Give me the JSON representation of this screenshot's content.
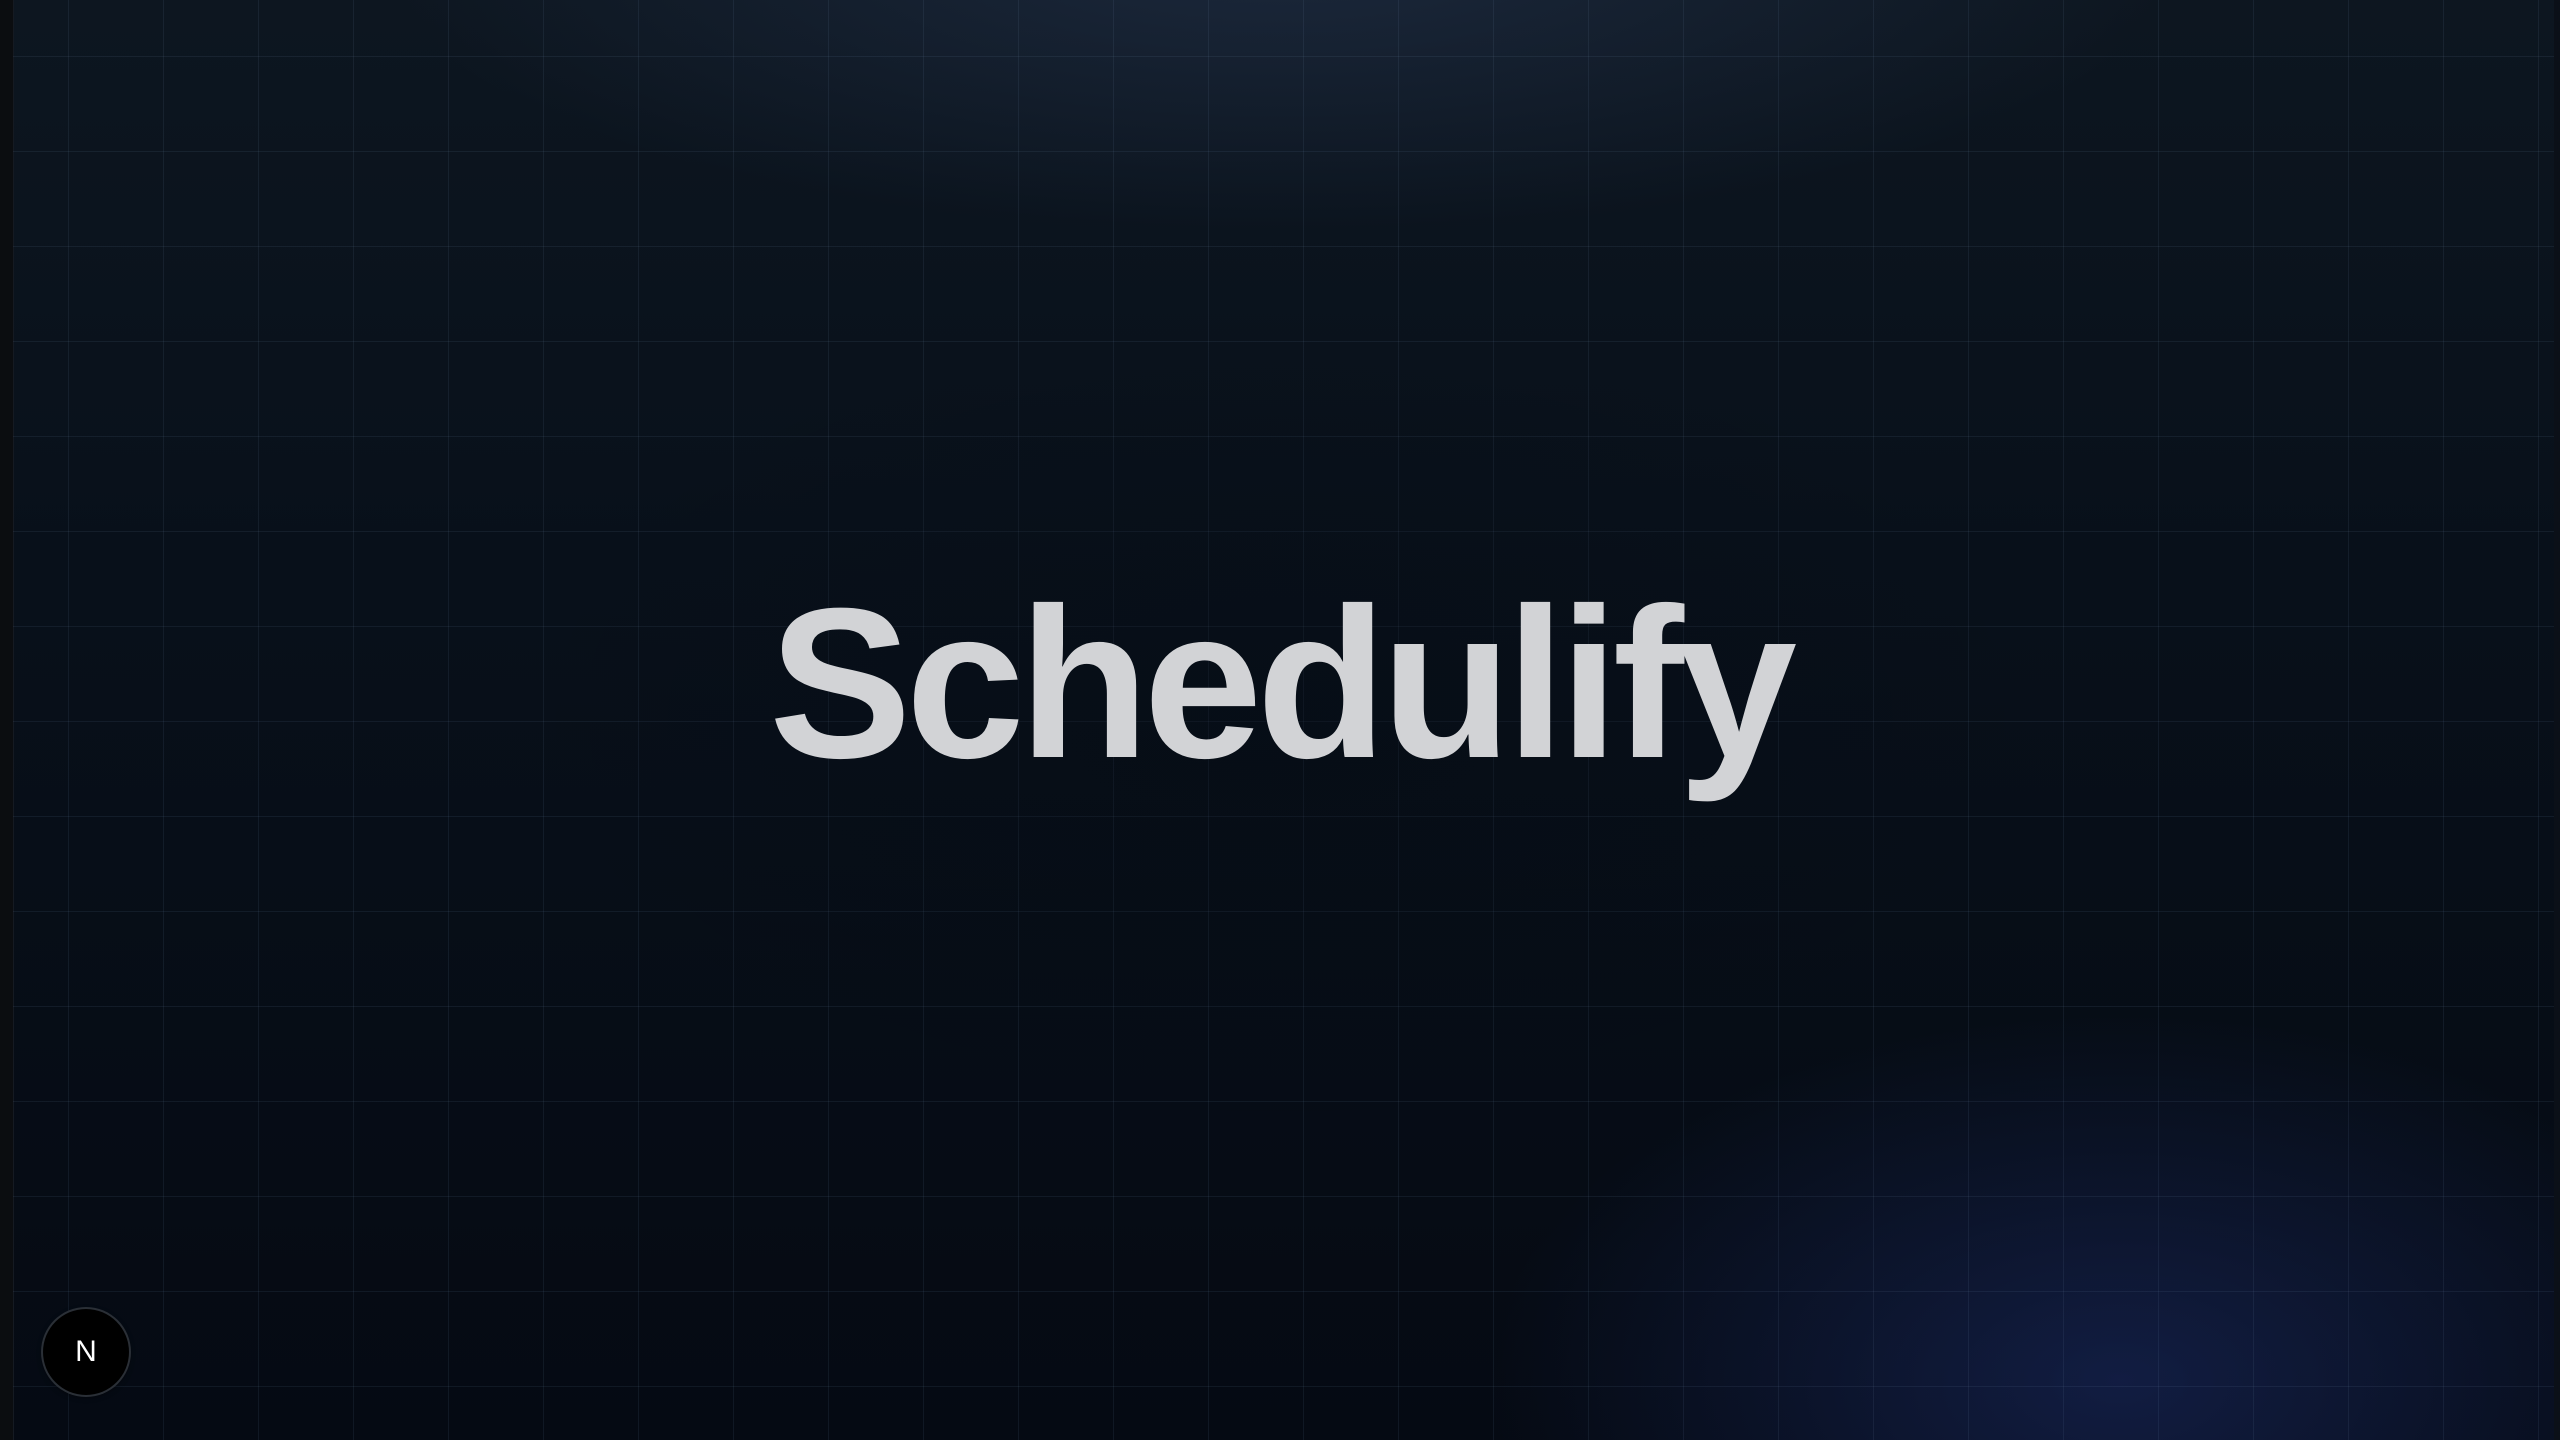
{
  "app": {
    "title": "Schedulify"
  },
  "dev_badge": {
    "letter": "N",
    "icon": "nextjs-logo-icon"
  },
  "colors": {
    "background": "#050a13",
    "title_text": "#d2d3d6",
    "grid_line": "#7896b9",
    "badge_background": "#000000"
  }
}
